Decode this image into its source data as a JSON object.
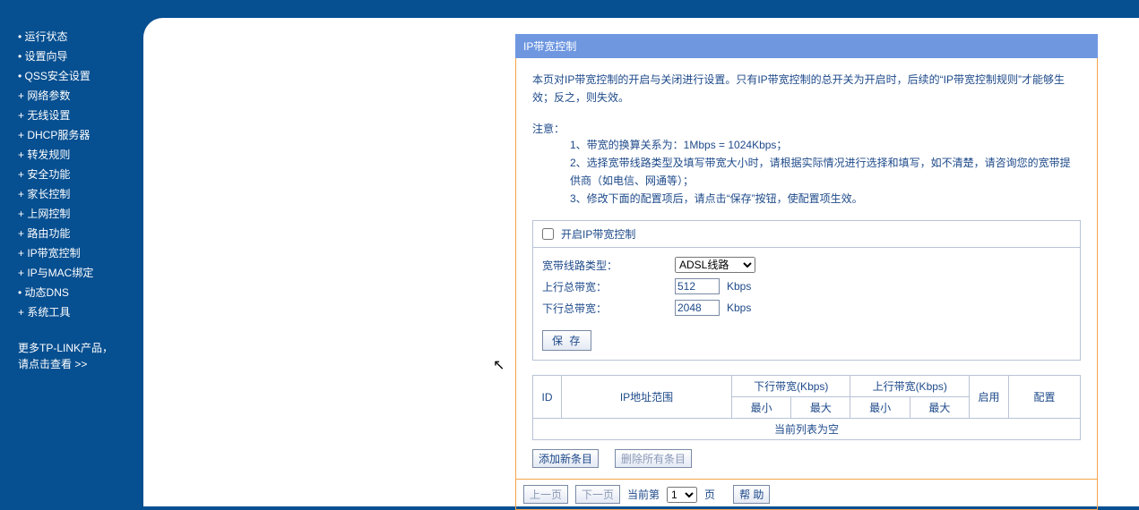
{
  "sidebar": {
    "items": [
      {
        "bullet": "•",
        "label": "运行状态"
      },
      {
        "bullet": "•",
        "label": "设置向导"
      },
      {
        "bullet": "•",
        "label": "QSS安全设置"
      },
      {
        "bullet": "+",
        "label": "网络参数"
      },
      {
        "bullet": "+",
        "label": "无线设置"
      },
      {
        "bullet": "+",
        "label": "DHCP服务器"
      },
      {
        "bullet": "+",
        "label": "转发规则"
      },
      {
        "bullet": "+",
        "label": "安全功能"
      },
      {
        "bullet": "+",
        "label": "家长控制"
      },
      {
        "bullet": "+",
        "label": "上网控制"
      },
      {
        "bullet": "+",
        "label": "路由功能"
      },
      {
        "bullet": "+",
        "label": "IP带宽控制"
      },
      {
        "bullet": "+",
        "label": "IP与MAC绑定"
      },
      {
        "bullet": "•",
        "label": "动态DNS"
      },
      {
        "bullet": "+",
        "label": "系统工具"
      }
    ],
    "promo_line1": "更多TP-LINK产品，",
    "promo_line2": "请点击查看 >>"
  },
  "panel": {
    "title": "IP带宽控制",
    "intro": "本页对IP带宽控制的开启与关闭进行设置。只有IP带宽控制的总开关为开启时，后续的“IP带宽控制规则”才能够生效；反之，则失效。",
    "note_head": "注意：",
    "notes": [
      "1、带宽的换算关系为：1Mbps = 1024Kbps；",
      "2、选择宽带线路类型及填写带宽大小时，请根据实际情况进行选择和填写，如不清楚，请咨询您的宽带提供商（如电信、网通等）；",
      "3、修改下面的配置项后，请点击“保存”按钮，使配置项生效。"
    ],
    "enable_label": "开启IP带宽控制",
    "line_type_label": "宽带线路类型：",
    "line_type_value": "ADSL线路",
    "up_label": "上行总带宽：",
    "up_value": "512",
    "down_label": "下行总带宽：",
    "down_value": "2048",
    "unit": "Kbps",
    "save_label": "保 存",
    "table": {
      "id": "ID",
      "ip_range": "IP地址范围",
      "down_group": "下行带宽(Kbps)",
      "up_group": "上行带宽(Kbps)",
      "min": "最小",
      "max": "最大",
      "enable": "启用",
      "config": "配置",
      "empty": "当前列表为空"
    },
    "add_label": "添加新条目",
    "del_label": "删除所有条目",
    "prev_label": "上一页",
    "next_label": "下一页",
    "page_prefix": "当前第",
    "page_value": "1",
    "page_suffix": "页",
    "help_label": "帮 助"
  }
}
